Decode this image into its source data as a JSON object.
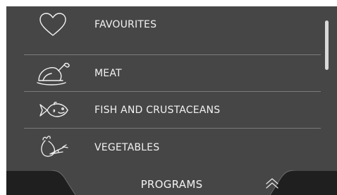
{
  "menu": {
    "items": [
      {
        "label": "FAVOURITES",
        "icon": "heart-icon"
      },
      {
        "label": "MEAT",
        "icon": "roast-chicken-icon"
      },
      {
        "label": "FISH AND CRUSTACEANS",
        "icon": "fish-icon"
      },
      {
        "label": "VEGETABLES",
        "icon": "vegetables-icon"
      }
    ]
  },
  "bottom_bar": {
    "title": "PROGRAMS",
    "collapse_icon": "double-chevron-up-icon"
  },
  "colors": {
    "background": "#464646",
    "text": "#f2f2f2",
    "divider": "#7a7a7a",
    "bar": "#1f1f1f",
    "scrollbar_thumb": "#d9d9d9"
  }
}
